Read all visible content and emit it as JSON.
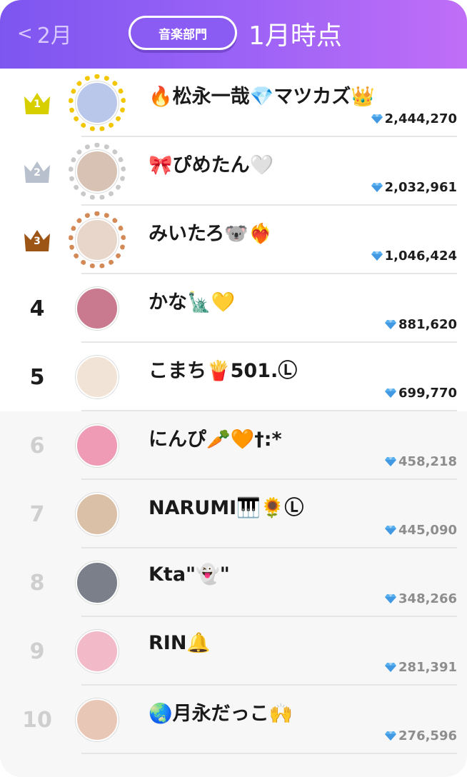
{
  "header": {
    "back_chevron": "<",
    "back_label": "2月",
    "category_pill": "音楽部門",
    "title": "1月時点"
  },
  "colors": {
    "header_gradient_start": "#7d56f0",
    "header_gradient_end": "#c06ef7",
    "crown_gold": "#d7cf00",
    "crown_silver": "#b7c0cc",
    "crown_bronze": "#9c5515",
    "gem": "#5ab0ef"
  },
  "rows": [
    {
      "rank": "1",
      "name": "🔥松永一哉💎マツカズ👑",
      "score": "2,444,270",
      "avatar_color": "#b9c7ea",
      "crown": "gold"
    },
    {
      "rank": "2",
      "name": "🎀ぴめたん🤍",
      "score": "2,032,961",
      "avatar_color": "#d8c2b4",
      "crown": "silver"
    },
    {
      "rank": "3",
      "name": "みいたろ🐨❤️‍🔥",
      "score": "1,046,424",
      "avatar_color": "#e9d6cb",
      "crown": "bronze"
    },
    {
      "rank": "4",
      "name": "かな🗽💛",
      "score": "881,620",
      "avatar_color": "#c97a8f",
      "crown": ""
    },
    {
      "rank": "5",
      "name": "こまち🍟501.Ⓛ",
      "score": "699,770",
      "avatar_color": "#f1e3d6",
      "crown": ""
    },
    {
      "rank": "6",
      "name": "にんぴ🥕🧡†:*",
      "score": "458,218",
      "avatar_color": "#ef9bb5",
      "crown": ""
    },
    {
      "rank": "7",
      "name": "NARUMI🎹🌻Ⓛ",
      "score": "445,090",
      "avatar_color": "#d9c0a6",
      "crown": ""
    },
    {
      "rank": "8",
      "name": "Kta\"👻\"",
      "score": "348,266",
      "avatar_color": "#7a7f8a",
      "crown": ""
    },
    {
      "rank": "9",
      "name": "RIN🔔",
      "score": "281,391",
      "avatar_color": "#f2b9c9",
      "crown": ""
    },
    {
      "rank": "10",
      "name": "🌏月永だっこ🙌",
      "score": "276,596",
      "avatar_color": "#e8c7b7",
      "crown": ""
    }
  ]
}
